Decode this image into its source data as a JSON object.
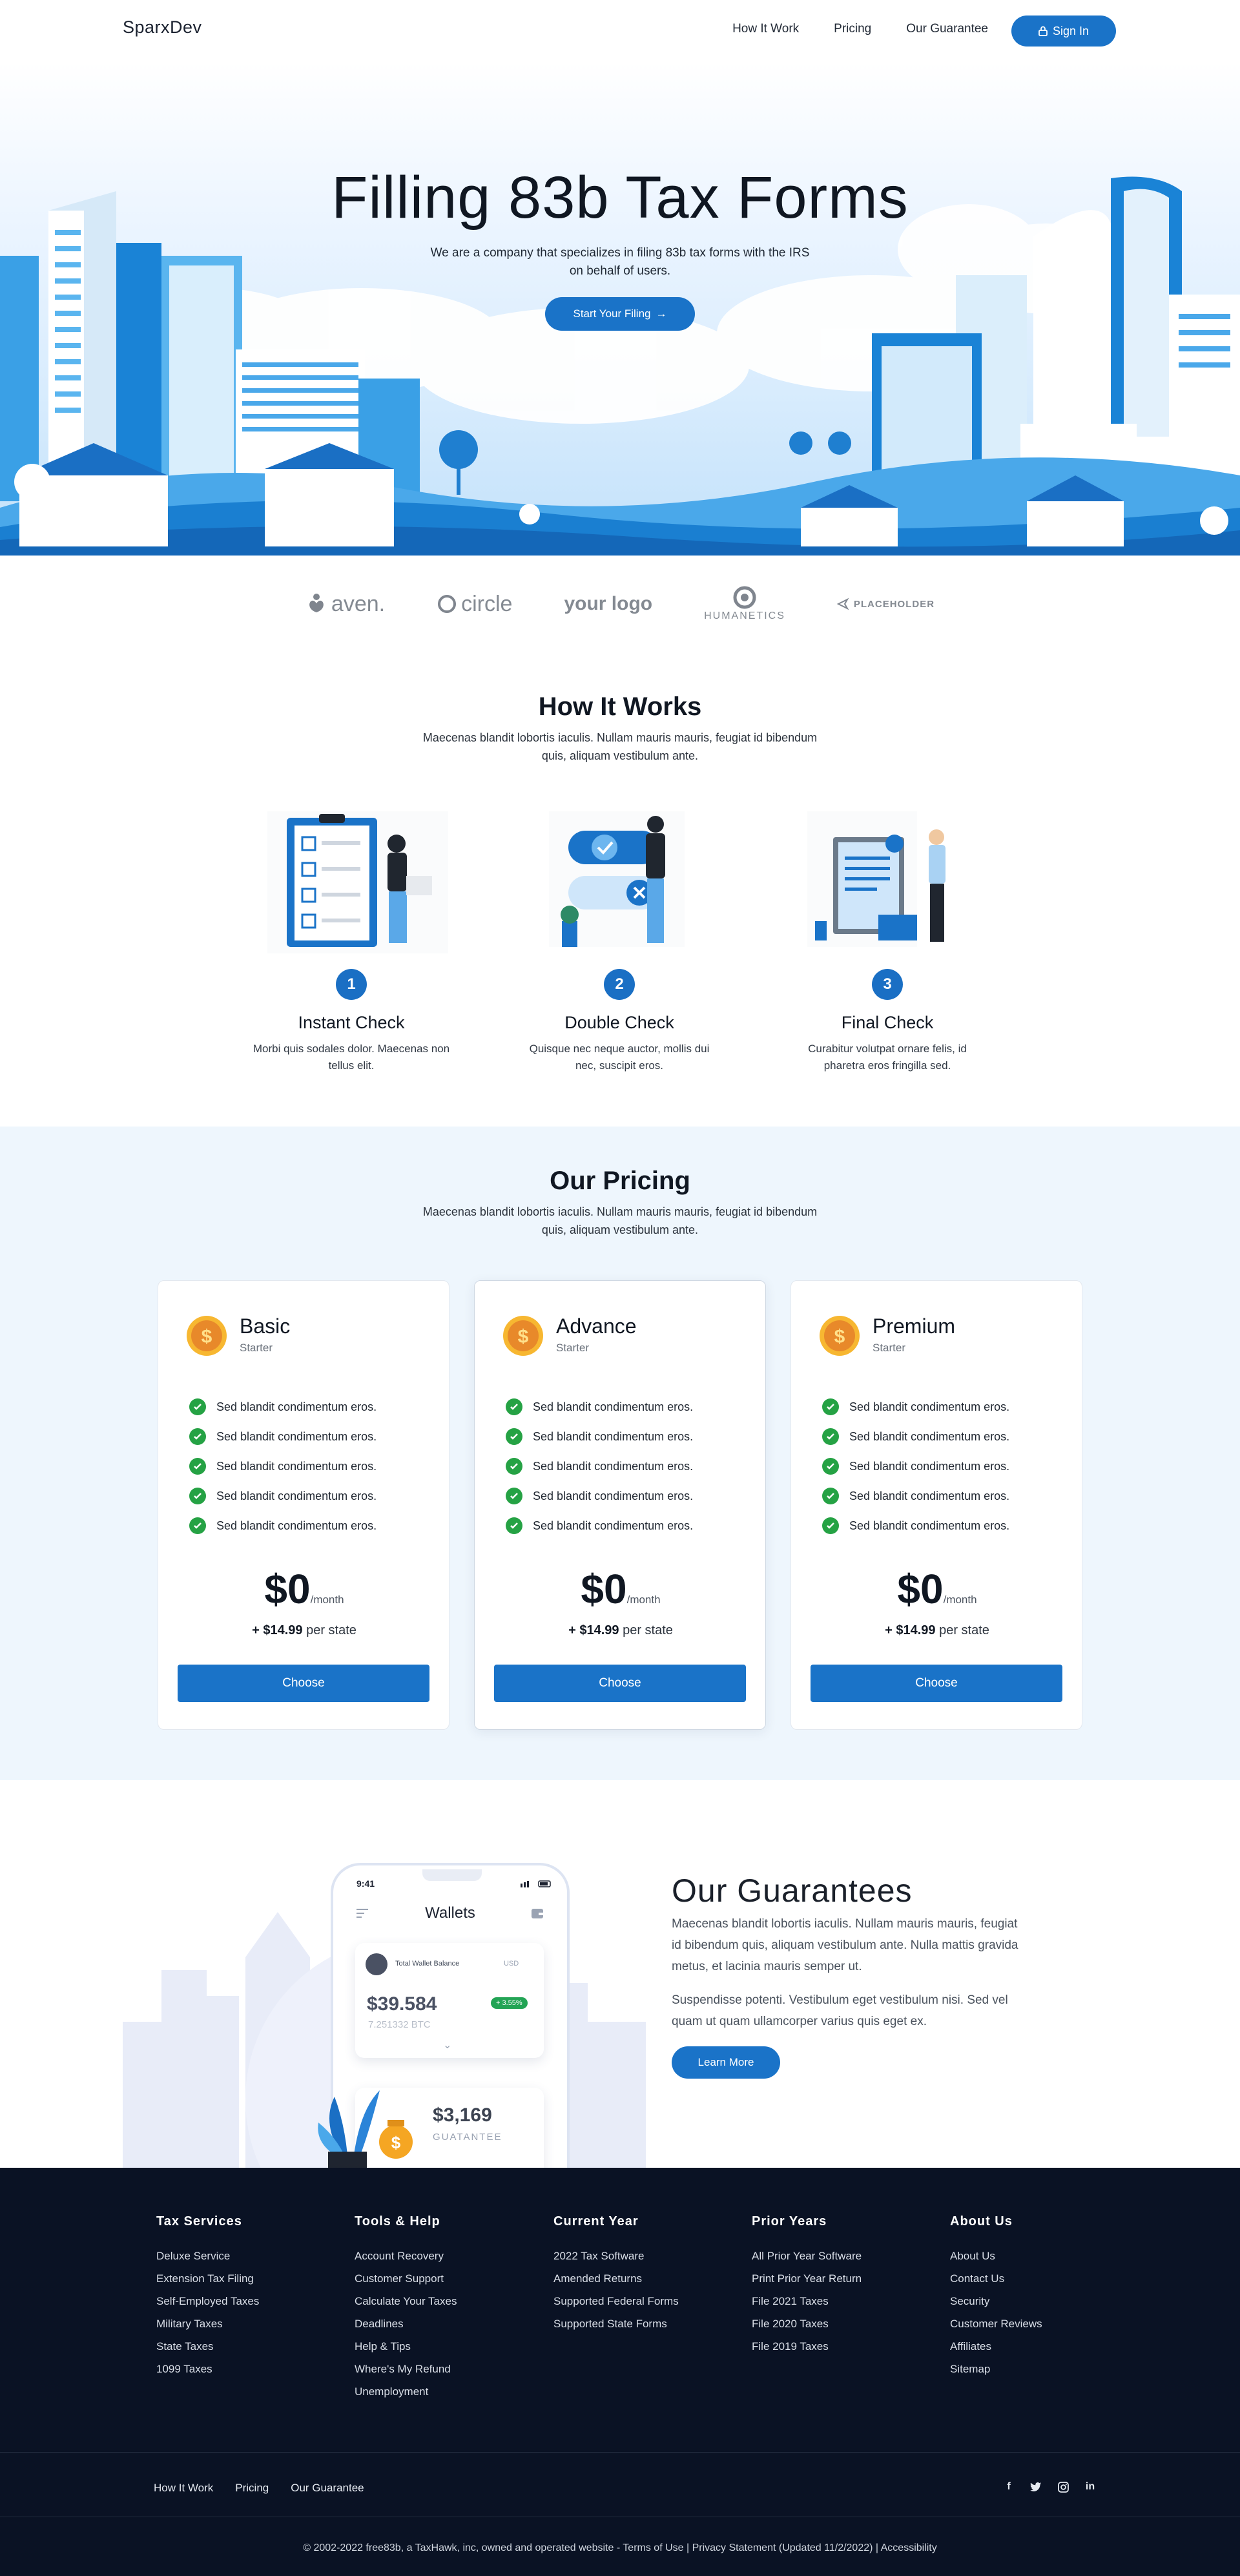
{
  "header": {
    "logo": "SparxDev",
    "nav": [
      "How It Work",
      "Pricing",
      "Our Guarantee"
    ],
    "signin_label": "Sign In"
  },
  "hero": {
    "title": "Filling 83b Tax Forms",
    "subtitle": "We are a company that specializes in filing 83b tax forms with the IRS on behalf of users.",
    "cta_label": "Start Your Filing"
  },
  "logos": [
    "aven.",
    "circle",
    "your logo",
    "HUMANETICS",
    "PLACEHOLDER"
  ],
  "how": {
    "title": "How It Works",
    "subtitle": "Maecenas blandit lobortis iaculis. Nullam mauris mauris, feugiat id bibendum quis, aliquam vestibulum ante.",
    "steps": [
      {
        "num": "1",
        "title": "Instant Check",
        "text": "Morbi quis sodales dolor. Maecenas non tellus elit."
      },
      {
        "num": "2",
        "title": "Double Check",
        "text": "Quisque nec neque auctor, mollis dui nec, suscipit eros."
      },
      {
        "num": "3",
        "title": "Final Check",
        "text": "Curabitur volutpat ornare felis, id pharetra eros fringilla sed."
      }
    ]
  },
  "pricing": {
    "title": "Our Pricing",
    "subtitle": "Maecenas blandit lobortis iaculis. Nullam mauris mauris, feugiat id bibendum quis, aliquam vestibulum ante.",
    "plans": [
      {
        "name": "Basic",
        "tier": "Starter",
        "features": [
          "Sed blandit condimentum eros.",
          "Sed blandit condimentum eros.",
          "Sed blandit condimentum eros.",
          "Sed blandit condimentum eros.",
          "Sed blandit condimentum eros."
        ],
        "price": "$0",
        "period": "/month",
        "state_price": "+ $14.99",
        "state_suffix": " per state",
        "cta": "Choose"
      },
      {
        "name": "Advance",
        "tier": "Starter",
        "features": [
          "Sed blandit condimentum eros.",
          "Sed blandit condimentum eros.",
          "Sed blandit condimentum eros.",
          "Sed blandit condimentum eros.",
          "Sed blandit condimentum eros."
        ],
        "price": "$0",
        "period": "/month",
        "state_price": "+ $14.99",
        "state_suffix": " per state",
        "cta": "Choose"
      },
      {
        "name": "Premium",
        "tier": "Starter",
        "features": [
          "Sed blandit condimentum eros.",
          "Sed blandit condimentum eros.",
          "Sed blandit condimentum eros.",
          "Sed blandit condimentum eros.",
          "Sed blandit condimentum eros."
        ],
        "price": "$0",
        "period": "/month",
        "state_price": "+ $14.99",
        "state_suffix": " per state",
        "cta": "Choose"
      }
    ]
  },
  "phone": {
    "time": "9:41",
    "title": "Wallets",
    "balance_label": "Total Wallet Balance",
    "currency": "USD",
    "balance": "$39.584",
    "btc": "7.251332 BTC",
    "change": "+ 3.55%",
    "amount2": "$3,169",
    "amount2_label": "GUATANTEE"
  },
  "guarantees": {
    "title": "Our Guarantees",
    "p1": "Maecenas blandit lobortis iaculis. Nullam mauris mauris, feugiat id bibendum quis, aliquam vestibulum ante. Nulla mattis gravida metus, et lacinia mauris semper ut.",
    "p2": "Suspendisse potenti. Vestibulum eget vestibulum nisi. Sed vel quam ut quam ullamcorper varius quis eget ex.",
    "cta": "Learn More"
  },
  "footer": {
    "columns": [
      {
        "title": "Tax Services",
        "items": [
          "Deluxe Service",
          "Extension Tax Filing",
          "Self-Employed Taxes",
          "Military Taxes",
          "State Taxes",
          "1099 Taxes"
        ]
      },
      {
        "title": "Tools & Help",
        "items": [
          "Account Recovery",
          "Customer Support",
          "Calculate Your Taxes",
          "Deadlines",
          "Help & Tips",
          "Where's My Refund",
          "Unemployment"
        ]
      },
      {
        "title": "Current Year",
        "items": [
          "2022 Tax Software",
          "Amended Returns",
          "Supported Federal Forms",
          "Supported State Forms"
        ]
      },
      {
        "title": "Prior Years",
        "items": [
          "All Prior Year Software",
          "Print Prior Year Return",
          "File 2021 Taxes",
          "File 2020 Taxes",
          "File 2019 Taxes"
        ]
      },
      {
        "title": "About Us",
        "items": [
          "About Us",
          "Contact Us",
          "Security",
          "Customer Reviews",
          "Affiliates",
          "Sitemap"
        ]
      }
    ],
    "bottom_nav": [
      "How It Work",
      "Pricing",
      "Our Guarantee"
    ],
    "social_icons": [
      "facebook-icon",
      "twitter-icon",
      "instagram-icon",
      "linkedin-icon"
    ],
    "copyright": "© 2002-2022 free83b, a TaxHawk, inc, owned and operated website - Terms of Use | Privacy Statement (Updated 11/2/2022) | Accessibility"
  },
  "colors": {
    "accent": "#1a73c8",
    "footer_bg": "#0a1224",
    "pricing_bg": "#eef6fd",
    "check": "#25a244"
  }
}
